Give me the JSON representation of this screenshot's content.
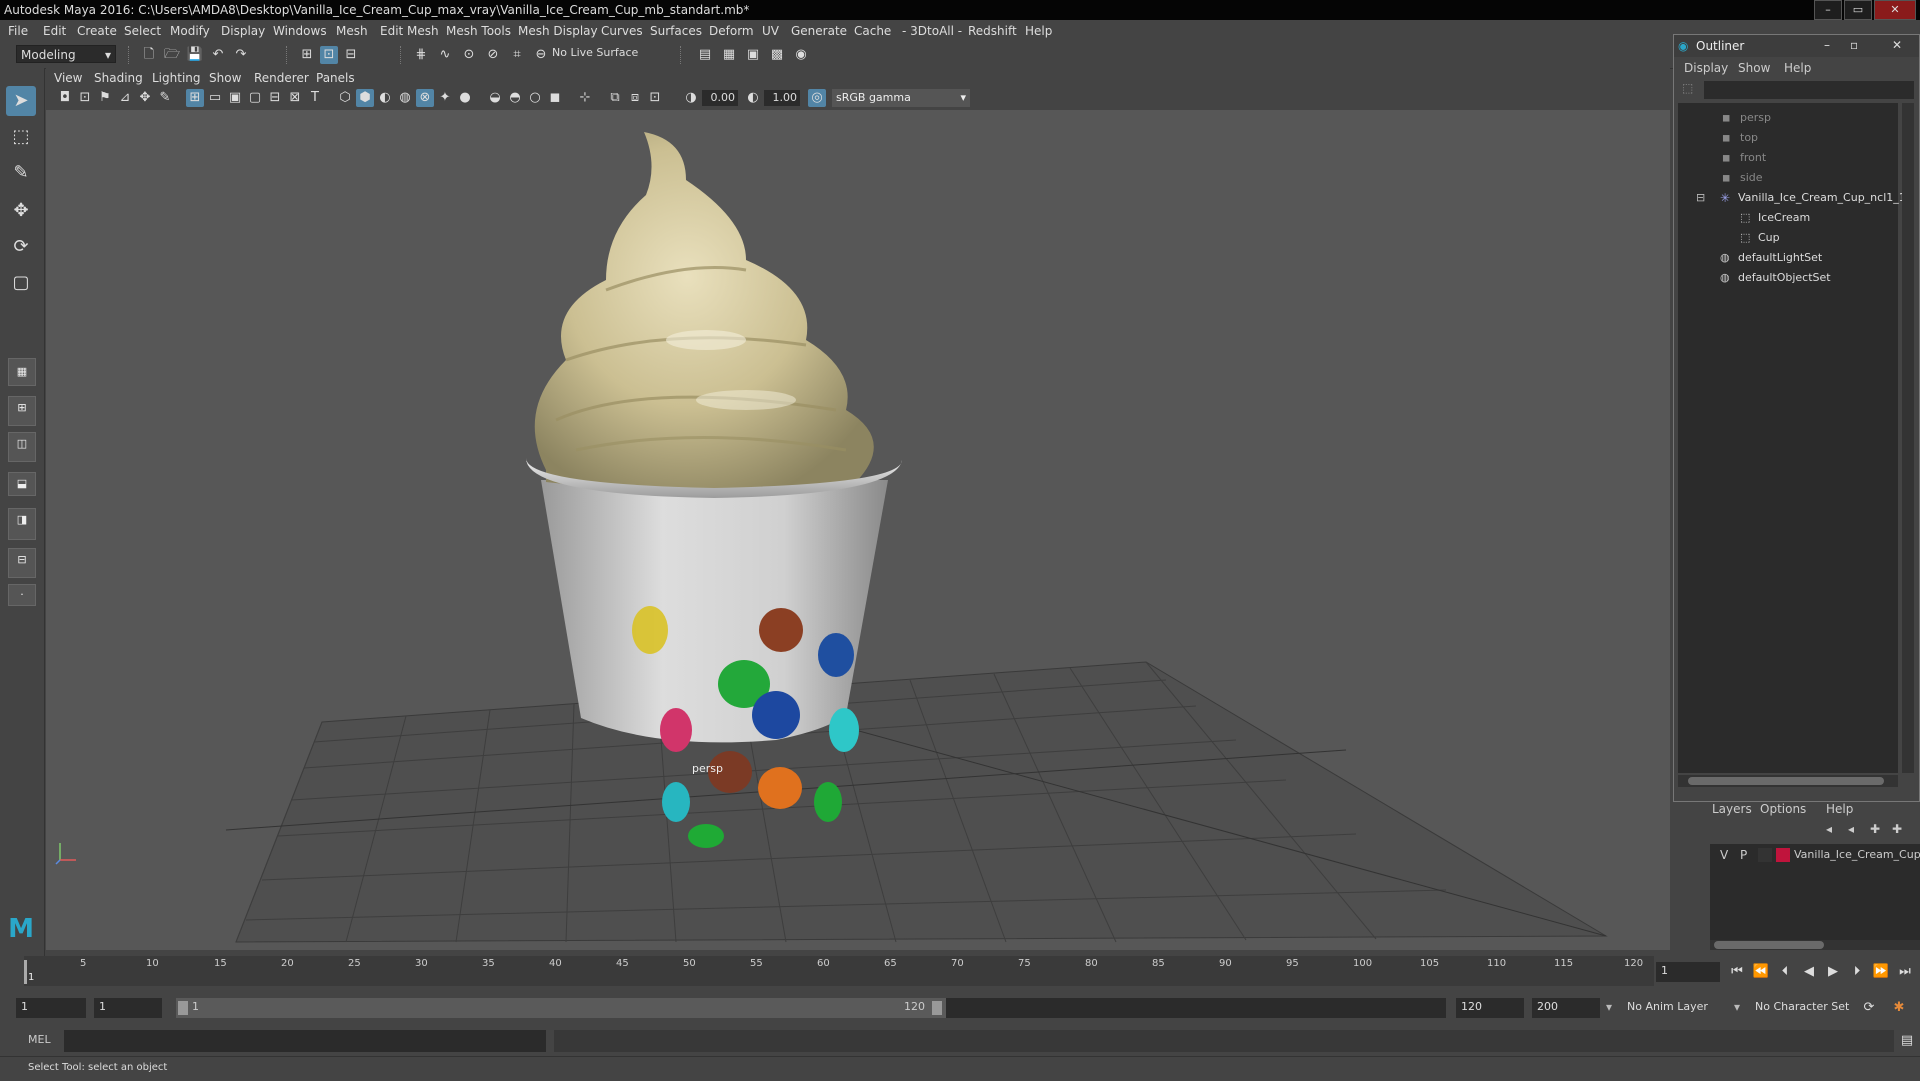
{
  "window": {
    "title": "Autodesk Maya 2016: C:\\Users\\AMDA8\\Desktop\\Vanilla_Ice_Cream_Cup_max_vray\\Vanilla_Ice_Cream_Cup_mb_standart.mb*",
    "min": "–",
    "max": "▭",
    "close": "✕"
  },
  "menubar": [
    "File",
    "Edit",
    "Create",
    "Select",
    "Modify",
    "Display",
    "Windows",
    "Mesh",
    "Edit Mesh",
    "Mesh Tools",
    "Mesh Display",
    "Curves",
    "Surfaces",
    "Deform",
    "UV",
    "Generate",
    "Cache",
    "- 3DtoAll -",
    "Redshift",
    "Help"
  ],
  "statusline": {
    "mode": "Modeling",
    "live_surface": "No Live Surface"
  },
  "viewport": {
    "menu": [
      "View",
      "Shading",
      "Lighting",
      "Show",
      "Renderer",
      "Panels"
    ],
    "exposure": "0.00",
    "gamma_value": "1.00",
    "color_space": "sRGB gamma",
    "camera_label": "persp"
  },
  "outliner": {
    "title": "Outliner",
    "menu": [
      "Display",
      "Show",
      "Help"
    ],
    "items": [
      {
        "label": "persp"
      },
      {
        "label": "top"
      },
      {
        "label": "front"
      },
      {
        "label": "side"
      },
      {
        "label": "Vanilla_Ice_Cream_Cup_ncl1_1"
      },
      {
        "label": "IceCream"
      },
      {
        "label": "Cup"
      },
      {
        "label": "defaultLightSet"
      },
      {
        "label": "defaultObjectSet"
      }
    ]
  },
  "layers": {
    "menu": [
      "Layers",
      "Options",
      "Help"
    ],
    "row": {
      "v": "V",
      "p": "P",
      "name": "Vanilla_Ice_Cream_Cup",
      "color": "#c0143c"
    }
  },
  "timeline": {
    "ticks": [
      "1",
      "5",
      "10",
      "15",
      "20",
      "25",
      "30",
      "35",
      "40",
      "45",
      "50",
      "55",
      "60",
      "65",
      "70",
      "75",
      "80",
      "85",
      "90",
      "95",
      "100",
      "105",
      "110",
      "115",
      "120"
    ],
    "current_frame": "1"
  },
  "range": {
    "start": "1",
    "playback_start": "1",
    "slider_start": "1",
    "slider_end": "120",
    "playback_end": "120",
    "end": "200",
    "anim_layer": "No Anim Layer",
    "character_set": "No Character Set"
  },
  "cmdline": {
    "label": "MEL"
  },
  "helpline": {
    "text": "Select Tool: select an object"
  },
  "colors": {
    "accent": "#5285a6",
    "viewport_bg": "#575757",
    "panel": "#444444"
  }
}
